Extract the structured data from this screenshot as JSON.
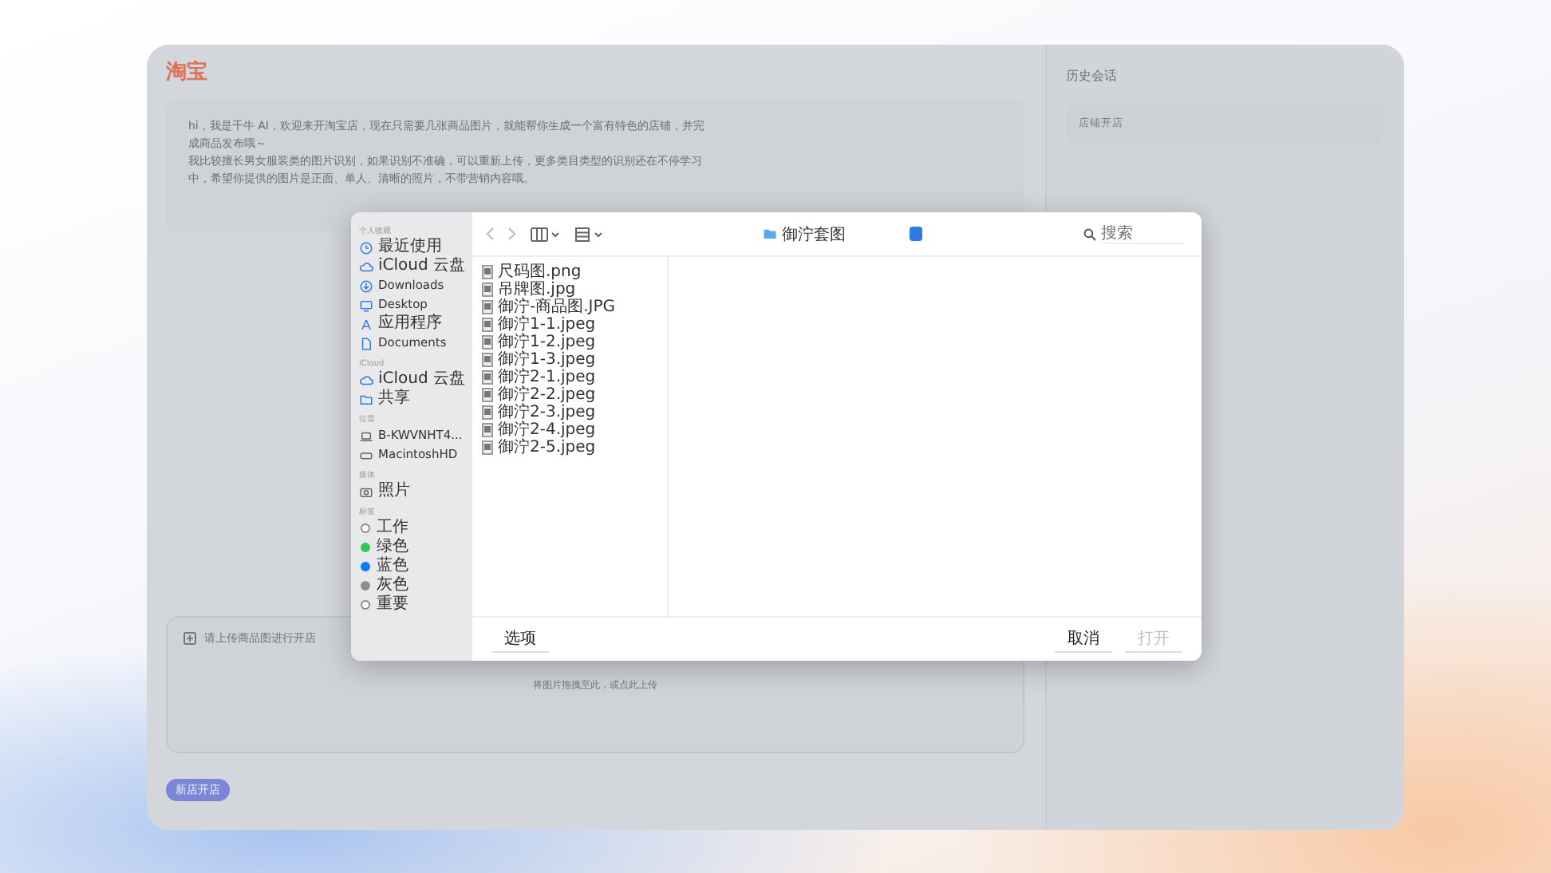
{
  "app": {
    "logo": "淘宝",
    "intro": [
      "hi，我是千牛 AI，欢迎来开淘宝店，现在只需要几张商品图片，就能帮你生成一个富有特色的店铺，并完成商品发布哦～",
      "我比较擅长男女服装类的图片识别，如果识别不准确，可以重新上传，更多类目类型的识别还在不停学习中，希望你提供的图片是正面、单人、清晰的照片，不带营销内容哦。"
    ],
    "upload": {
      "title": "请上传商品图进行开店",
      "hint": "将图片拖拽至此，或点此上传"
    },
    "new_shop_button": "新店开店"
  },
  "history": {
    "title": "历史会话",
    "items": [
      {
        "label": "店铺开店",
        "selected": false
      }
    ]
  },
  "dialog": {
    "location": "御泞套图",
    "search": {
      "placeholder": "搜索"
    },
    "sidebar": [
      {
        "header": "个人收藏",
        "items": [
          {
            "label": "最近使用",
            "kind": "clock"
          },
          {
            "label": "iCloud 云盘",
            "kind": "cloud"
          },
          {
            "label": "Downloads",
            "kind": "download"
          },
          {
            "label": "Desktop",
            "kind": "monitor"
          },
          {
            "label": "应用程序",
            "kind": "apps"
          },
          {
            "label": "Documents",
            "kind": "document"
          }
        ]
      },
      {
        "header": "iCloud",
        "items": [
          {
            "label": "iCloud 云盘",
            "kind": "cloud"
          },
          {
            "label": "共享",
            "kind": "folder"
          }
        ]
      },
      {
        "header": "位置",
        "items": [
          {
            "label": "B-KWVNHT4...",
            "kind": "laptop"
          },
          {
            "label": "MacintoshHD",
            "kind": "disk"
          }
        ]
      },
      {
        "header": "媒体",
        "items": [
          {
            "label": "照片",
            "kind": "photo"
          }
        ]
      },
      {
        "header": "标签",
        "items": [
          {
            "label": "工作",
            "kind": "tag",
            "color": "#ffffff"
          },
          {
            "label": "绿色",
            "kind": "tag",
            "color": "#34c759"
          },
          {
            "label": "蓝色",
            "kind": "tag",
            "color": "#0a7aff"
          },
          {
            "label": "灰色",
            "kind": "tag",
            "color": "#8e8e93"
          },
          {
            "label": "重要",
            "kind": "tag",
            "color": "#ffffff"
          }
        ]
      }
    ],
    "files": [
      "尺码图.png",
      "吊牌图.jpg",
      "御泞-商品图.JPG",
      "御泞1-1.jpeg",
      "御泞1-2.jpeg",
      "御泞1-3.jpeg",
      "御泞2-1.jpeg",
      "御泞2-2.jpeg",
      "御泞2-3.jpeg",
      "御泞2-4.jpeg",
      "御泞2-5.jpeg"
    ],
    "options_button": "选项",
    "buttons": [
      {
        "label": "取消",
        "disabled": false
      },
      {
        "label": "打开",
        "disabled": true
      }
    ]
  }
}
